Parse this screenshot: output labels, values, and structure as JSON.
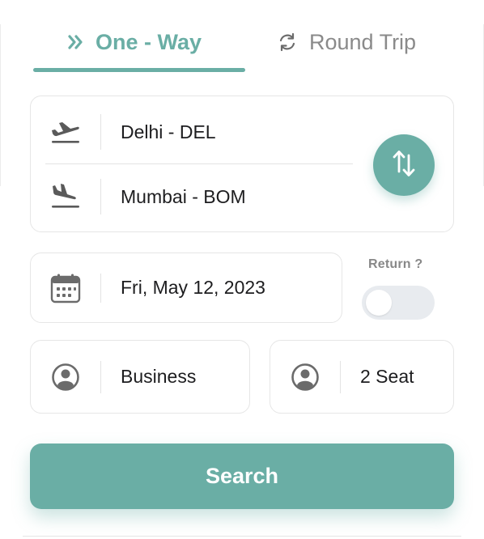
{
  "tabs": {
    "one_way": {
      "label": "One - Way",
      "icon": "double-chevron-right-icon",
      "active": true
    },
    "round_trip": {
      "label": "Round Trip",
      "icon": "refresh-icon",
      "active": false
    }
  },
  "route": {
    "from": {
      "value": "Delhi - DEL",
      "icon": "flight-takeoff-icon"
    },
    "to": {
      "value": "Mumbai - BOM",
      "icon": "flight-landing-icon"
    },
    "swap_icon": "swap-vertical-icon"
  },
  "date": {
    "value": "Fri, May 12, 2023",
    "icon": "calendar-icon"
  },
  "return": {
    "label": "Return ?",
    "enabled": false
  },
  "cabin_class": {
    "value": "Business",
    "icon": "user-circle-icon"
  },
  "seats": {
    "value": "2 Seat",
    "icon": "user-circle-icon"
  },
  "search": {
    "label": "Search"
  },
  "colors": {
    "accent": "#6aaea5",
    "muted_text": "#8a8a8a",
    "toggle_off": "#e8ebef"
  }
}
